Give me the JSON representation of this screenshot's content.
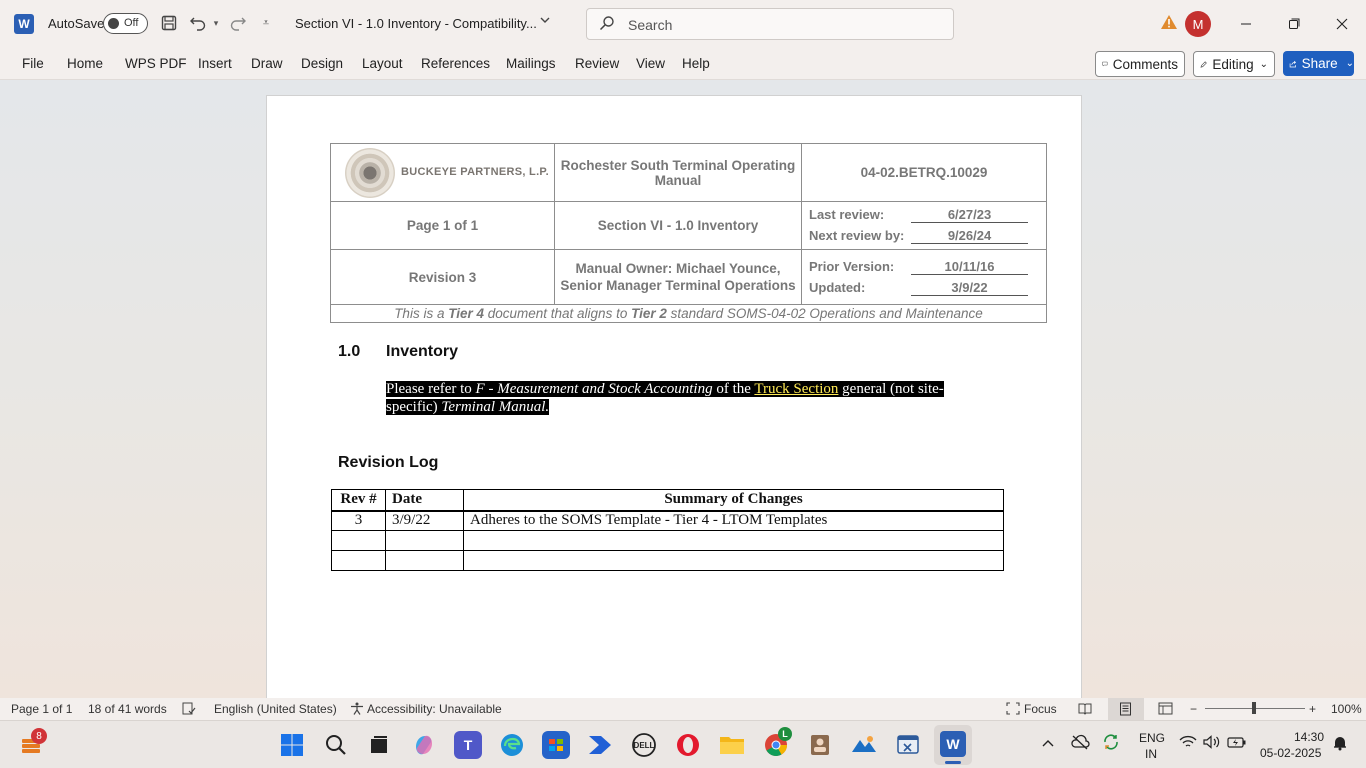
{
  "titlebar": {
    "app_icon_letter": "W",
    "autosave_label": "AutoSave",
    "autosave_state": "Off",
    "doc_title": "Section VI - 1.0 Inventory  -  Compatibility...",
    "search_placeholder": "Search",
    "avatar_initial": "M"
  },
  "menu": {
    "items": [
      "File",
      "Home",
      "WPS PDF",
      "Insert",
      "Draw",
      "Design",
      "Layout",
      "References",
      "Mailings",
      "Review",
      "View",
      "Help"
    ],
    "comments": "Comments",
    "editing": "Editing",
    "share": "Share"
  },
  "doc": {
    "company": "BUCKEYE PARTNERS, L.P.",
    "manual_title": "Rochester South Terminal Operating Manual",
    "doc_number": "04-02.BETRQ.10029",
    "page": "Page 1 of 1",
    "section": "Section VI - 1.0 Inventory",
    "last_review_label": "Last review:",
    "last_review": "6/27/23",
    "next_review_label": "Next review by:",
    "next_review": "9/26/24",
    "revision": "Revision 3",
    "owner_line1": "Manual Owner: Michael Younce,",
    "owner_line2": "Senior Manager Terminal Operations",
    "prior_label": "Prior Version:",
    "prior": "10/11/16",
    "updated_label": "Updated:",
    "updated": "3/9/22",
    "tier_pre": "This is a ",
    "tier4": "Tier 4",
    "tier_mid": " document that aligns to ",
    "tier2": "Tier 2",
    "tier_post": " standard SOMS-04-02 Operations and Maintenance",
    "heading_num": "1.0",
    "heading_text": "Inventory",
    "para_1": "Please refer to ",
    "para_2": "F - Measurement and Stock Accounting",
    "para_3": " of the ",
    "para_4": "Truck Section",
    "para_5": " general (not site-",
    "para_6": "specific) ",
    "para_7": "Terminal Manual.",
    "revlog_heading": "Revision Log",
    "revlog": {
      "headers": [
        "Rev #",
        "Date",
        "Summary of Changes"
      ],
      "rows": [
        [
          "3",
          "3/9/22",
          "Adheres to the SOMS Template - Tier 4 - LTOM Templates"
        ],
        [
          "",
          "",
          ""
        ],
        [
          "",
          "",
          ""
        ]
      ]
    }
  },
  "status": {
    "page": "Page 1 of 1",
    "words": "18 of 41 words",
    "language": "English (United States)",
    "accessibility": "Accessibility: Unavailable",
    "focus": "Focus",
    "zoom": "100%"
  },
  "taskbar": {
    "notification_count": "8",
    "chrome_badge": "L",
    "lang_line1": "ENG",
    "lang_line2": "IN",
    "time": "14:30",
    "date": "05-02-2025"
  },
  "colors": {
    "word_blue": "#2b5fb4",
    "share_blue": "#1f5fbf",
    "avatar_red": "#c4312f",
    "highlight_yellow": "#ffea55"
  }
}
